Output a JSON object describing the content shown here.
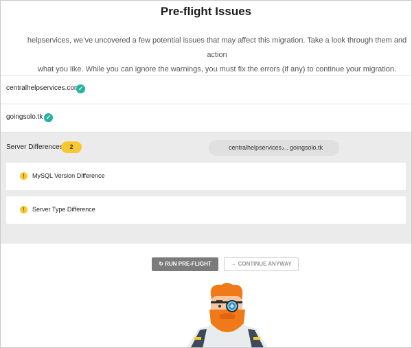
{
  "page": {
    "title": "Pre-flight Issues",
    "intro_line1": "helpservices, we’ve uncovered a few potential issues that may affect this migration. Take a look through them and action",
    "intro_line2": "what you like. While you can ignore the warnings, you must fix the errors (if any) to continue your migration."
  },
  "sites": [
    {
      "name": "centralhelpservices.com",
      "status_icon": "check-icon"
    },
    {
      "name": "goingsolo.tk",
      "status_icon": "check-icon"
    }
  ],
  "server_differences": {
    "label": "Server Differences",
    "count": "2",
    "source": "centralhelpservices....",
    "arrow": "›",
    "destination": "goingsolo.tk",
    "issues": [
      {
        "label": "MySQL Version Difference",
        "icon": "warning-icon"
      },
      {
        "label": "Server Type Difference",
        "icon": "warning-icon"
      }
    ]
  },
  "buttons": {
    "run": "RUN PRE-FLIGHT",
    "run_icon": "↻",
    "continue": "CONTINUE ANYWAY",
    "continue_icon": "→"
  },
  "colors": {
    "check": "#21b2a3",
    "badge": "#f7c82f",
    "run_button": "#7b7b7b"
  }
}
